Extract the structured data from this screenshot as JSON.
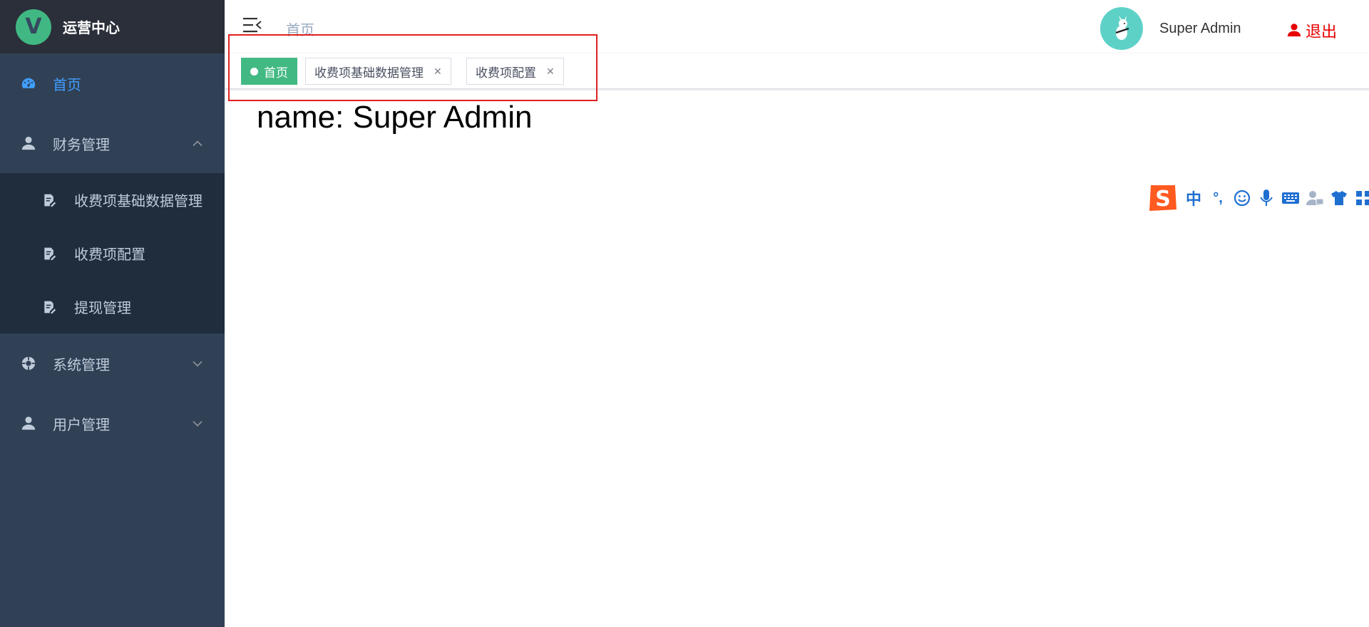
{
  "sidebar": {
    "logo_letter": "V",
    "title": "运营中心",
    "items": [
      {
        "label": "首页",
        "icon": "dashboard-icon",
        "active": true
      },
      {
        "label": "财务管理",
        "icon": "user-icon",
        "expanded": true,
        "children": [
          {
            "label": "收费项基础数据管理",
            "icon": "edit-document-icon"
          },
          {
            "label": "收费项配置",
            "icon": "edit-document-icon"
          },
          {
            "label": "提现管理",
            "icon": "edit-document-icon"
          }
        ]
      },
      {
        "label": "系统管理",
        "icon": "settings-icon",
        "expanded": false
      },
      {
        "label": "用户管理",
        "icon": "user-icon",
        "expanded": false
      }
    ]
  },
  "header": {
    "breadcrumb": "首页",
    "username": "Super Admin",
    "logout_label": "退出"
  },
  "tags": [
    {
      "label": "首页",
      "active": true
    },
    {
      "label": "收费项基础数据管理",
      "closable": true
    },
    {
      "label": "收费项配置",
      "closable": true
    }
  ],
  "main": {
    "text": "name: Super Admin"
  },
  "ime_toolbar": {
    "mode": "中",
    "punct": "°,"
  },
  "colors": {
    "sidebar_bg": "#304156",
    "submenu_bg": "#1f2d3d",
    "active_menu": "#409eff",
    "active_tag": "#42b983",
    "logout": "#e80000",
    "highlight": "#e02020"
  }
}
